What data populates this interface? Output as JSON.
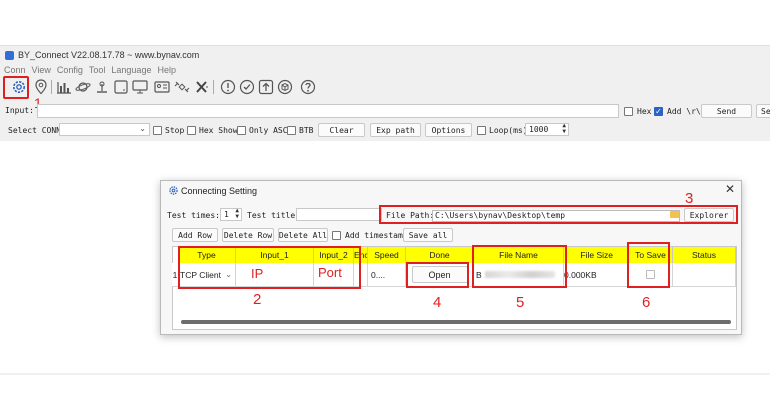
{
  "window": {
    "title": "BY_Connect V22.08.17.78 ~ www.bynav.com"
  },
  "menu": [
    "Conn",
    "View",
    "Config",
    "Tool",
    "Language",
    "Help"
  ],
  "toolbar": {
    "icons": [
      "settings-gear",
      "location-pin",
      "bar-chart",
      "planet",
      "tilt-sensor",
      "terminal-window",
      "monitor",
      "id-card",
      "satellite",
      "crosshair-x",
      "info-circle",
      "shield-check",
      "upload-box",
      "cube",
      "help-circle"
    ]
  },
  "annotations": {
    "n1": "1",
    "n2": "2",
    "n3": "3",
    "n4": "4",
    "n5": "5",
    "n6": "6",
    "ip": "IP",
    "port": "Port"
  },
  "input_row": {
    "label": "Input:",
    "hex_label": "Hex",
    "add_rn_label": "Add \\r\\n",
    "add_rn_checked": true,
    "send_label": "Send",
    "se_label": "Se"
  },
  "conn_row": {
    "select_label": "Select CONN:",
    "stop_label": "Stop",
    "hex_show_label": "Hex Show",
    "only_asc_label": "Only ASC",
    "btb_label": "BTB",
    "clear_label": "Clear",
    "exp_path_label": "Exp path",
    "options_label": "Options",
    "loop_label": "Loop(ms)",
    "loop_value": "1000"
  },
  "dialog": {
    "title": "Connecting Setting",
    "test_times_label": "Test times:",
    "test_times_value": "1",
    "test_title_label": "Test title:",
    "file_path_label": "File Path:",
    "file_path_value": "C:\\Users\\bynav\\Desktop\\temp",
    "explorer_label": "Explorer",
    "add_row_label": "Add Row",
    "delete_row_label": "Delete Row",
    "delete_all_label": "Delete All",
    "add_timestamp_label": "Add timestamp",
    "save_all_label": "Save all",
    "columns": [
      "Type",
      "Input_1",
      "Input_2",
      "Enc",
      "Speed",
      "Done",
      "File Name",
      "File Size",
      "To Save",
      "Status"
    ],
    "row": {
      "index": "1",
      "type": "TCP Client",
      "speed": "0....",
      "done_button": "Open",
      "file_name": "B",
      "file_size": "0.000KB"
    }
  },
  "colors": {
    "header_highlight": "#ffff00",
    "annotation_red": "#e02020",
    "accent": "#2c62c4"
  }
}
